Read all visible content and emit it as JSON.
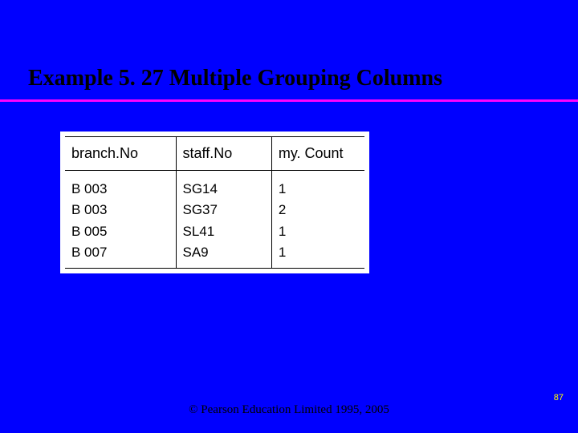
{
  "title": "Example 5. 27  Multiple Grouping Columns",
  "table": {
    "headers": [
      "branch.No",
      "staff.No",
      "my. Count"
    ],
    "columns": [
      [
        "B 003",
        "B 003",
        "B 005",
        "B 007"
      ],
      [
        "SG14",
        "SG37",
        "SL41",
        "SA9"
      ],
      [
        "1",
        "2",
        "1",
        "1"
      ]
    ]
  },
  "footer": "© Pearson Education Limited 1995, 2005",
  "page_number": "87",
  "chart_data": {
    "type": "table",
    "title": "Example 5.27 Multiple Grouping Columns",
    "headers": [
      "branch.No",
      "staff.No",
      "my.Count"
    ],
    "rows": [
      [
        "B003",
        "SG14",
        1
      ],
      [
        "B003",
        "SG37",
        2
      ],
      [
        "B005",
        "SL41",
        1
      ],
      [
        "B007",
        "SA9",
        1
      ]
    ]
  }
}
